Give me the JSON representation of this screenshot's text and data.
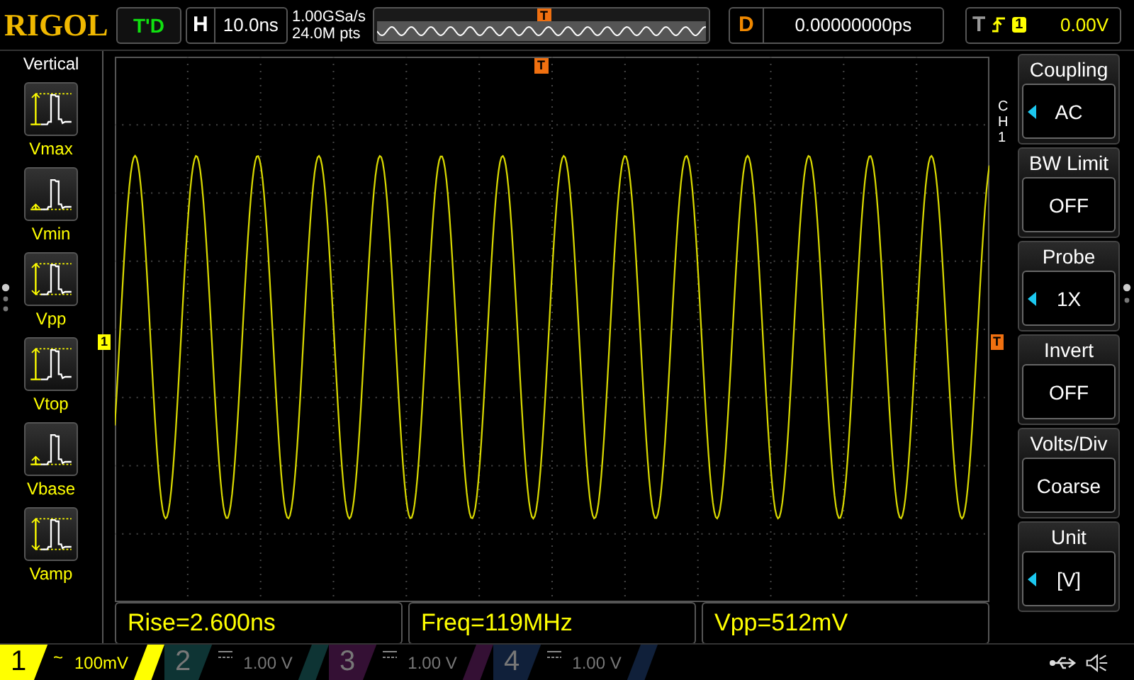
{
  "logo": "RIGOL",
  "run_status": "T'D",
  "horizontal": {
    "label": "H",
    "timebase": "10.0ns"
  },
  "sample_rate": "1.00GSa/s",
  "memory_depth": "24.0M pts",
  "timeline_marker": "T",
  "delay": {
    "label": "D",
    "value": "0.00000000ps"
  },
  "trigger": {
    "label": "T",
    "source": "1",
    "level": "0.00V"
  },
  "left_menu": {
    "title": "Vertical",
    "items": [
      {
        "label": "Vmax",
        "kind": "max"
      },
      {
        "label": "Vmin",
        "kind": "min"
      },
      {
        "label": "Vpp",
        "kind": "pp"
      },
      {
        "label": "Vtop",
        "kind": "top"
      },
      {
        "label": "Vbase",
        "kind": "base"
      },
      {
        "label": "Vamp",
        "kind": "amp"
      }
    ]
  },
  "markers": {
    "channel": "1",
    "trigger_position": "T",
    "trigger_level": "T"
  },
  "right_menu": {
    "channel": "CH1",
    "items": [
      {
        "title": "Coupling",
        "value": "AC",
        "adjustable": true
      },
      {
        "title": "BW Limit",
        "value": "OFF",
        "adjustable": false
      },
      {
        "title": "Probe",
        "value": "1X",
        "adjustable": true
      },
      {
        "title": "Invert",
        "value": "OFF",
        "adjustable": false
      },
      {
        "title": "Volts/Div",
        "value": "Coarse",
        "adjustable": false
      },
      {
        "title": "Unit",
        "value": "[V]",
        "adjustable": true
      }
    ]
  },
  "measurements": [
    "Rise=2.600ns",
    "Freq=119MHz",
    "Vpp=512mV"
  ],
  "channels": [
    {
      "number": "1",
      "kind": "ac",
      "coupling_symbol": "~",
      "scale": "100mV",
      "selected": true,
      "color": "#ffff00"
    },
    {
      "number": "2",
      "kind": "dc",
      "scale": "1.00 V",
      "selected": false,
      "color": "#0e3434"
    },
    {
      "number": "3",
      "kind": "dc",
      "scale": "1.00 V",
      "selected": false,
      "color": "#341034"
    },
    {
      "number": "4",
      "kind": "dc",
      "scale": "1.00 V",
      "selected": false,
      "color": "#10203a"
    }
  ]
}
